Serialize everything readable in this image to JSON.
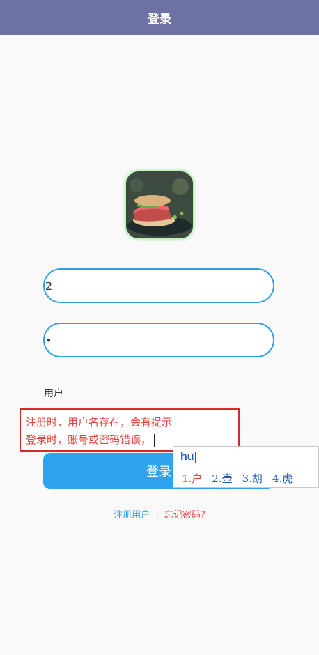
{
  "header": {
    "title": "登录"
  },
  "form": {
    "username_value": "2",
    "password_value": "•",
    "username_label": "用户",
    "login_label": "登录"
  },
  "note": {
    "line1": "注册时，用户名存在，会有提示",
    "line2": "登录时，账号或密码错误，"
  },
  "links": {
    "register": "注册用户",
    "separator": "|",
    "forgot": "忘记密码?"
  },
  "ime": {
    "input": "hu",
    "candidates": [
      "1.户",
      "2.壶",
      "3.胡",
      "4.虎"
    ]
  },
  "colors": {
    "header_bg": "#6e71a3",
    "accent": "#2ea3ef",
    "warning": "#e8413d"
  }
}
